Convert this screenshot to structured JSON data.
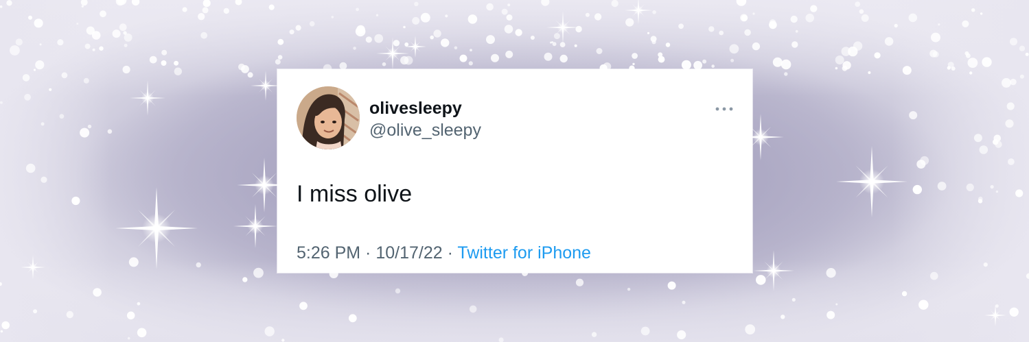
{
  "tweet": {
    "display_name": "olivesleepy",
    "handle": "@olive_sleepy",
    "text": "I miss olive",
    "time": "5:26 PM",
    "separator": " · ",
    "date": "10/17/22",
    "source": "Twitter for iPhone"
  },
  "icons": {
    "more": "more-horizontal-icon",
    "avatar": "avatar-illustration"
  },
  "colors": {
    "background": "#b4b1c9",
    "card": "#ffffff",
    "name": "#0f1419",
    "secondary": "#536471",
    "link": "#1d9bf0"
  }
}
